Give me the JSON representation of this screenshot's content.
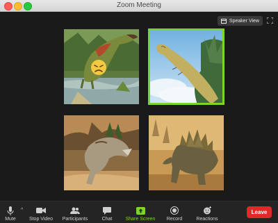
{
  "window": {
    "title": "Zoom Meeting"
  },
  "view": {
    "speaker_view_label": "Speaker View"
  },
  "participants": [
    {
      "name": "Parasaurolophus",
      "emoji": "😣",
      "active": false
    },
    {
      "name": "Brachiosaurus",
      "active": true
    },
    {
      "name": "Ceratosaurus",
      "active": false
    },
    {
      "name": "Stegosaurus",
      "active": false
    }
  ],
  "toolbar": {
    "mute": "Mute",
    "stop_video": "Stop Video",
    "participants": "Participants",
    "chat": "Chat",
    "share_screen": "Share Screen",
    "record": "Record",
    "reactions": "Reactions",
    "leave": "Leave"
  },
  "colors": {
    "active_speaker": "#7ad62a",
    "leave": "#e02a2a",
    "share": "#7ad62a"
  }
}
